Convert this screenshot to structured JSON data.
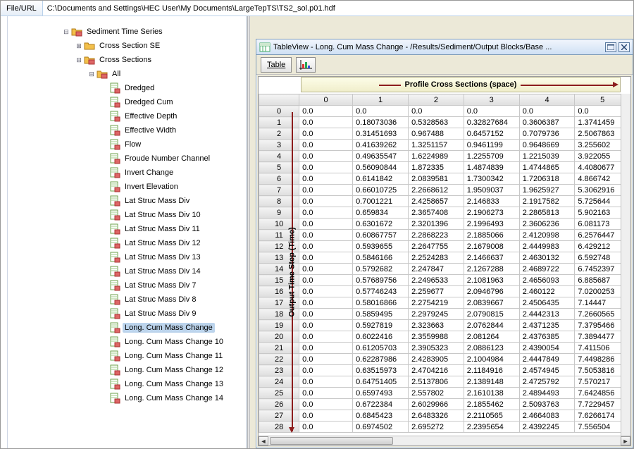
{
  "filebar": {
    "label": "File/URL",
    "value": "C:\\Documents and Settings\\HEC User\\My Documents\\LargeTepTS\\TS2_sol.p01.hdf"
  },
  "tree": {
    "root": "Sediment Time Series",
    "n_cross_se": "Cross Section SE",
    "n_cross": "Cross Sections",
    "n_all": "All",
    "leaves": [
      "Dredged",
      "Dredged Cum",
      "Effective Depth",
      "Effective Width",
      "Flow",
      "Froude Number Channel",
      "Invert Change",
      "Invert Elevation",
      "Lat Struc Mass Div",
      "Lat Struc Mass Div 10",
      "Lat Struc Mass Div 11",
      "Lat Struc Mass Div 12",
      "Lat Struc Mass Div 13",
      "Lat Struc Mass Div 14",
      "Lat Struc Mass Div 7",
      "Lat Struc Mass Div 8",
      "Lat Struc Mass Div 9",
      "Long. Cum Mass Change",
      "Long. Cum Mass Change 10",
      "Long. Cum Mass Change 11",
      "Long. Cum Mass Change 12",
      "Long. Cum Mass Change 13",
      "Long. Cum Mass Change 14"
    ],
    "selected": "Long. Cum Mass Change"
  },
  "tableview": {
    "title": "TableView  -  Long. Cum Mass Change  -  /Results/Sediment/Output Blocks/Base ...",
    "table_btn": "Table",
    "profile_header": "Profile Cross Sections (space)",
    "time_header": "Output Time Step (Time)",
    "cols": [
      "0",
      "1",
      "2",
      "3",
      "4",
      "5"
    ],
    "rows": [
      {
        "n": "0",
        "v": [
          "0.0",
          "0.0",
          "0.0",
          "0.0",
          "0.0",
          "0.0"
        ]
      },
      {
        "n": "1",
        "v": [
          "0.0",
          "0.18073036",
          "0.5328563",
          "0.32827684",
          "0.3606387",
          "1.3741459"
        ]
      },
      {
        "n": "2",
        "v": [
          "0.0",
          "0.31451693",
          "0.967488",
          "0.6457152",
          "0.7079736",
          "2.5067863"
        ]
      },
      {
        "n": "3",
        "v": [
          "0.0",
          "0.41639262",
          "1.3251157",
          "0.9461199",
          "0.9648669",
          "3.255602"
        ]
      },
      {
        "n": "4",
        "v": [
          "0.0",
          "0.49635547",
          "1.6224989",
          "1.2255709",
          "1.2215039",
          "3.922055"
        ]
      },
      {
        "n": "5",
        "v": [
          "0.0",
          "0.56090844",
          "1.872335",
          "1.4874839",
          "1.4744865",
          "4.4080677"
        ]
      },
      {
        "n": "6",
        "v": [
          "0.0",
          "0.6141842",
          "2.0839581",
          "1.7300342",
          "1.7206318",
          "4.866742"
        ]
      },
      {
        "n": "7",
        "v": [
          "0.0",
          "0.66010725",
          "2.2668612",
          "1.9509037",
          "1.9625927",
          "5.3062916"
        ]
      },
      {
        "n": "8",
        "v": [
          "0.0",
          "0.7001221",
          "2.4258657",
          "2.146833",
          "2.1917582",
          "5.725644"
        ]
      },
      {
        "n": "9",
        "v": [
          "0.0",
          "0.659834",
          "2.3657408",
          "2.1906273",
          "2.2865813",
          "5.902163"
        ]
      },
      {
        "n": "10",
        "v": [
          "0.0",
          "0.6301672",
          "2.3201396",
          "2.1996493",
          "2.3606236",
          "6.081173"
        ]
      },
      {
        "n": "11",
        "v": [
          "0.0",
          "0.60867757",
          "2.2868223",
          "2.1885066",
          "2.4120998",
          "6.2576447"
        ]
      },
      {
        "n": "12",
        "v": [
          "0.0",
          "0.5939655",
          "2.2647755",
          "2.1679008",
          "2.4449983",
          "6.429212"
        ]
      },
      {
        "n": "13",
        "v": [
          "0.0",
          "0.5846166",
          "2.2524283",
          "2.1466637",
          "2.4630132",
          "6.592748"
        ]
      },
      {
        "n": "14",
        "v": [
          "0.0",
          "0.5792682",
          "2.247847",
          "2.1267288",
          "2.4689722",
          "6.7452397"
        ]
      },
      {
        "n": "15",
        "v": [
          "0.0",
          "0.57689756",
          "2.2496533",
          "2.1081963",
          "2.4656093",
          "6.885687"
        ]
      },
      {
        "n": "16",
        "v": [
          "0.0",
          "0.57746243",
          "2.259677",
          "2.0946796",
          "2.460122",
          "7.0200253"
        ]
      },
      {
        "n": "17",
        "v": [
          "0.0",
          "0.58016866",
          "2.2754219",
          "2.0839667",
          "2.4506435",
          "7.14447"
        ]
      },
      {
        "n": "18",
        "v": [
          "0.0",
          "0.5859495",
          "2.2979245",
          "2.0790815",
          "2.4442313",
          "7.2660565"
        ]
      },
      {
        "n": "19",
        "v": [
          "0.0",
          "0.5927819",
          "2.323663",
          "2.0762844",
          "2.4371235",
          "7.3795466"
        ]
      },
      {
        "n": "20",
        "v": [
          "0.0",
          "0.6022416",
          "2.3559988",
          "2.081264",
          "2.4376385",
          "7.3894477"
        ]
      },
      {
        "n": "21",
        "v": [
          "0.0",
          "0.61205703",
          "2.3905323",
          "2.0886123",
          "2.4390054",
          "7.411506"
        ]
      },
      {
        "n": "22",
        "v": [
          "0.0",
          "0.62287986",
          "2.4283905",
          "2.1004984",
          "2.4447849",
          "7.4498286"
        ]
      },
      {
        "n": "23",
        "v": [
          "0.0",
          "0.63515973",
          "2.4704216",
          "2.1184916",
          "2.4574945",
          "7.5053816"
        ]
      },
      {
        "n": "24",
        "v": [
          "0.0",
          "0.64751405",
          "2.5137806",
          "2.1389148",
          "2.4725792",
          "7.570217"
        ]
      },
      {
        "n": "25",
        "v": [
          "0.0",
          "0.6597493",
          "2.557802",
          "2.1610138",
          "2.4894493",
          "7.6424856"
        ]
      },
      {
        "n": "26",
        "v": [
          "0.0",
          "0.6722384",
          "2.6029966",
          "2.1855462",
          "2.5093763",
          "7.7229457"
        ]
      },
      {
        "n": "27",
        "v": [
          "0.0",
          "0.6845423",
          "2.6483326",
          "2.2110565",
          "2.4664083",
          "7.6266174"
        ]
      },
      {
        "n": "28",
        "v": [
          "0.0",
          "0.6974502",
          "2.695272",
          "2.2395654",
          "2.4392245",
          "7.556504"
        ]
      }
    ]
  }
}
